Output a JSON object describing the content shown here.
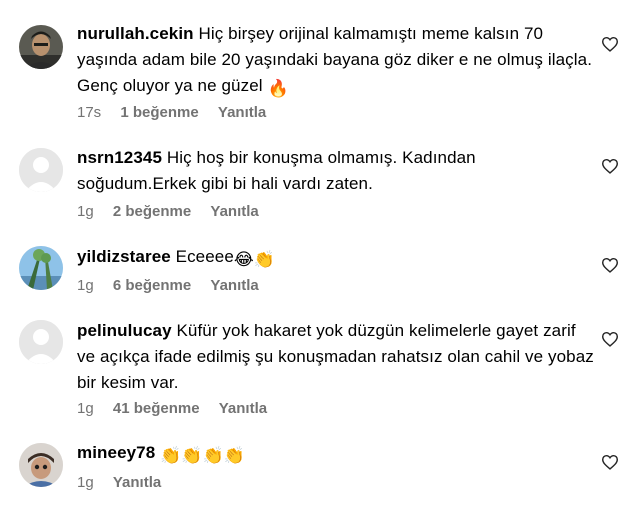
{
  "comments": [
    {
      "username": "nurullah.cekin",
      "text": "Hiç birşey orijinal kalmamıştı meme kalsın 70 yaşında adam bile 20 yaşındaki bayana göz diker e ne olmuş ilaçla. Genç oluyor ya ne güzel",
      "emoji": "🔥",
      "time": "17s",
      "likes": "1 beğenme",
      "reply": "Yanıtla"
    },
    {
      "username": "nsrn12345",
      "text": "Hiç hoş bir konuşma olmamış. Kadından soğudum.Erkek gibi bi hali vardı zaten.",
      "time": "1g",
      "likes": "2 beğenme",
      "reply": "Yanıtla"
    },
    {
      "username": "yildizstaree",
      "text": "Eceeee",
      "emoji": "😂👏",
      "time": "1g",
      "likes": "6 beğenme",
      "reply": "Yanıtla"
    },
    {
      "username": "pelinulucay",
      "text": "Küfür yok hakaret yok düzgün kelimelerle gayet zarif ve açıkça ifade edilmiş şu konuşmadan rahatsız olan cahil ve yobaz bir kesim var.",
      "time": "1g",
      "likes": "41 beğenme",
      "reply": "Yanıtla"
    },
    {
      "username": "mineey78",
      "text": "",
      "emoji": "👏👏👏👏",
      "time": "1g",
      "reply": "Yanıtla"
    }
  ],
  "icons": {
    "like": "heart-outline-icon",
    "avatar_default": "default-avatar-icon"
  },
  "colors": {
    "text": "#000000",
    "meta": "#737373",
    "avatar_placeholder": "#e6e6e6"
  }
}
